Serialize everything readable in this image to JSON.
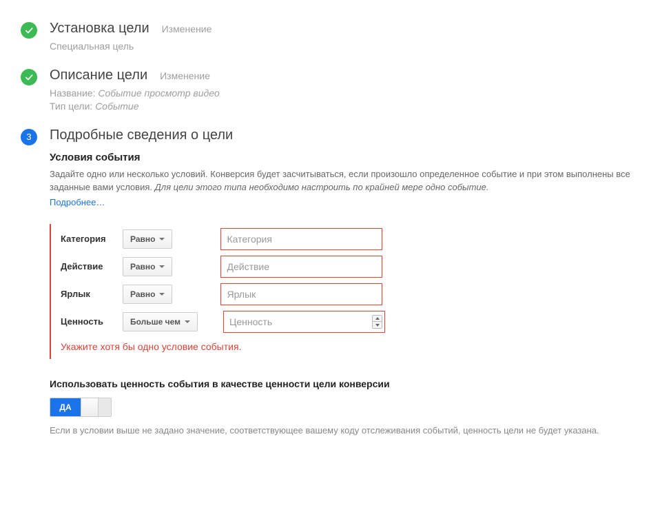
{
  "step1": {
    "title": "Установка цели",
    "edit": "Изменение",
    "subtitle": "Специальная цель"
  },
  "step2": {
    "title": "Описание цели",
    "edit": "Изменение",
    "name_label": "Название:",
    "name_value": "Событие просмотр видео",
    "type_label": "Тип цели:",
    "type_value": "Событие"
  },
  "step3": {
    "number": "3",
    "title": "Подробные сведения о цели",
    "conditions": {
      "heading": "Условия события",
      "desc_plain": "Задайте одно или несколько условий. Конверсия будет засчитываться, если произошло определенное событие и при этом выполнены все заданные вами условия. ",
      "desc_italic": "Для цели этого типа необходимо настроить по крайней мере одно событие.",
      "learn_more": "Подробнее…",
      "rows": {
        "category": {
          "label": "Категория",
          "op": "Равно",
          "placeholder": "Категория"
        },
        "action": {
          "label": "Действие",
          "op": "Равно",
          "placeholder": "Действие"
        },
        "tag": {
          "label": "Ярлык",
          "op": "Равно",
          "placeholder": "Ярлык"
        },
        "value": {
          "label": "Ценность",
          "op": "Больше чем",
          "placeholder": "Ценность"
        }
      },
      "error": "Укажите хотя бы одно условие события."
    },
    "value_section": {
      "heading": "Использовать ценность события в качестве ценности цели конверсии",
      "toggle_on": "ДА",
      "hint": "Если в условии выше не задано значение, соответствующее вашему коду отслеживания событий, ценность цели не будет указана."
    }
  }
}
